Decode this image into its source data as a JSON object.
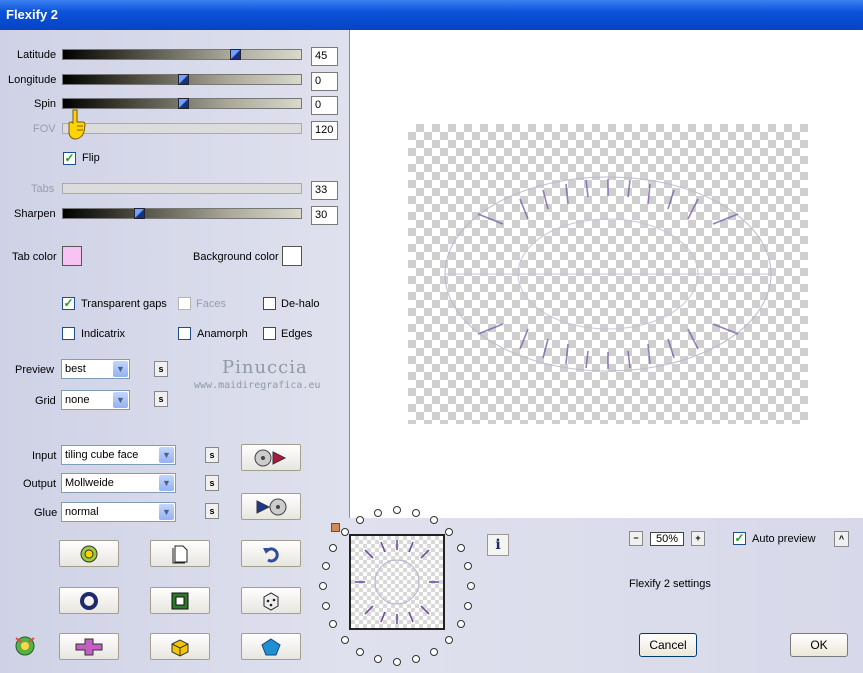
{
  "window": {
    "title": "Flexify 2"
  },
  "sliders": [
    {
      "label": "Latitude",
      "value": "45",
      "position": 0.73,
      "enabled": true
    },
    {
      "label": "Longitude",
      "value": "0",
      "position": 0.5,
      "enabled": true
    },
    {
      "label": "Spin",
      "value": "0",
      "position": 0.5,
      "enabled": true
    },
    {
      "label": "FOV",
      "value": "120",
      "position": 0.0,
      "enabled": false
    },
    {
      "label": "Tabs",
      "value": "33",
      "position": 0.0,
      "enabled": false
    },
    {
      "label": "Sharpen",
      "value": "30",
      "position": 0.31,
      "enabled": true
    }
  ],
  "flip": {
    "label": "Flip",
    "checked": true
  },
  "colors": {
    "tab_color_label": "Tab color",
    "tab_color": "#f7c3f3",
    "background_color_label": "Background color",
    "background_color": "#ffffff"
  },
  "options": {
    "transparent_gaps": {
      "label": "Transparent gaps",
      "checked": true
    },
    "faces": {
      "label": "Faces",
      "checked": false
    },
    "de_halo": {
      "label": "De-halo",
      "checked": false
    },
    "indicatrix": {
      "label": "Indicatrix",
      "checked": false
    },
    "anamorph": {
      "label": "Anamorph",
      "checked": false
    },
    "edges": {
      "label": "Edges",
      "checked": false
    }
  },
  "preview": {
    "label": "Preview",
    "value": "best"
  },
  "grid": {
    "label": "Grid",
    "value": "none"
  },
  "watermark": {
    "name": "Pinuccia",
    "url": "www.maidiregrafica.eu"
  },
  "input": {
    "label": "Input",
    "value": "tiling cube face"
  },
  "output": {
    "label": "Output",
    "value": "Mollweide"
  },
  "glue": {
    "label": "Glue",
    "value": "normal"
  },
  "s_button": "s",
  "zoom": {
    "value": "50%",
    "minus": "−",
    "plus": "+"
  },
  "auto_preview": {
    "label": "Auto preview",
    "checked": true,
    "collapse": "^"
  },
  "settings_label": "Flexify 2 settings",
  "buttons": {
    "cancel": "Cancel",
    "ok": "OK"
  },
  "info_icon": "i",
  "icons": [
    "preset-icon",
    "new-page-icon",
    "undo-icon",
    "circle-icon",
    "square-frame-icon",
    "dice-icon",
    "cross-icon",
    "cube-icon",
    "pentagon-icon",
    "eye-logo-icon"
  ]
}
